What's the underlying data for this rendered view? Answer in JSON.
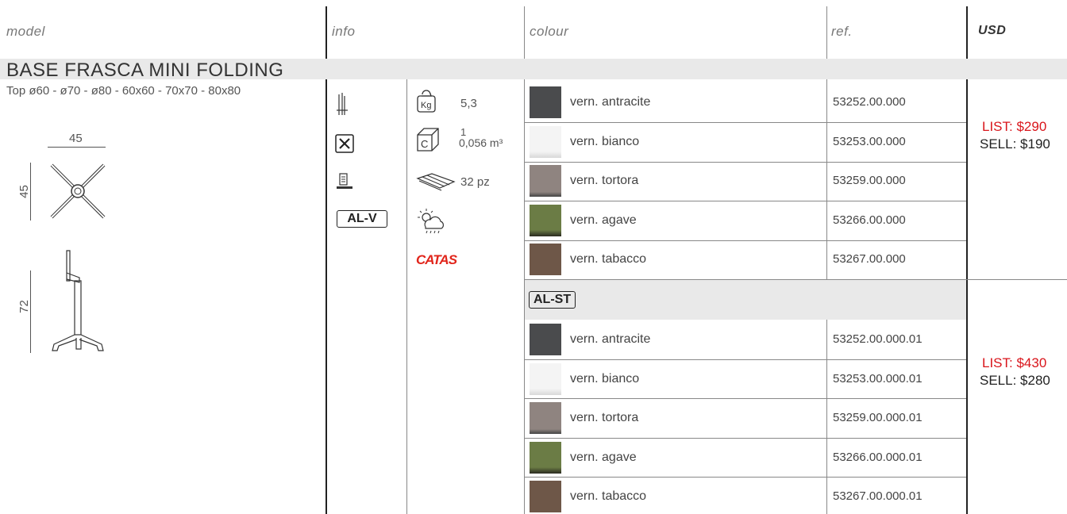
{
  "headers": {
    "model": "model",
    "info": "info",
    "colour": "colour",
    "ref": "ref.",
    "usd": "USD"
  },
  "title": "BASE FRASCA MINI FOLDING",
  "top_sizes": "Top  ø60 - ø70 - ø80 - 60x60 - 70x70 - 80x80",
  "dims": {
    "width": "45",
    "depth": "45",
    "height": "72"
  },
  "info_badge": "AL-V",
  "specs": {
    "weight": "5,3",
    "pack_qty": "1",
    "pack_volume": "0,056 m³",
    "pallet": "32 pz",
    "catas": "CATAS"
  },
  "variant_badge": "AL-ST",
  "colours_1": [
    {
      "name": "vern. antracite",
      "ref": "53252.00.000",
      "color": "#4a4b4d"
    },
    {
      "name": "vern. bianco",
      "ref": "53253.00.000",
      "color": "#f2f2f2"
    },
    {
      "name": "vern. tortora",
      "ref": "53259.00.000",
      "color": "#8f8480"
    },
    {
      "name": "vern. agave",
      "ref": "53266.00.000",
      "color": "#6b7c45"
    },
    {
      "name": "vern. tabacco",
      "ref": "53267.00.000",
      "color": "#6e5748"
    }
  ],
  "colours_2": [
    {
      "name": "vern. antracite",
      "ref": "53252.00.000.01",
      "color": "#4a4b4d"
    },
    {
      "name": "vern. bianco",
      "ref": "53253.00.000.01",
      "color": "#f2f2f2"
    },
    {
      "name": "vern. tortora",
      "ref": "53259.00.000.01",
      "color": "#8f8480"
    },
    {
      "name": "vern. agave",
      "ref": "53266.00.000.01",
      "color": "#6b7c45"
    },
    {
      "name": "vern. tabacco",
      "ref": "53267.00.000.01",
      "color": "#6e5748"
    }
  ],
  "price_1": {
    "list": "LIST: $290",
    "sell": "SELL: $190"
  },
  "price_2": {
    "list": "LIST: $430",
    "sell": "SELL: $280"
  }
}
